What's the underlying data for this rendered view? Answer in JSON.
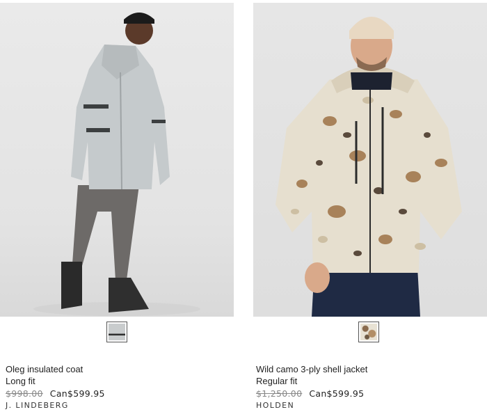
{
  "products": [
    {
      "name": "Oleg insulated coat",
      "fit": "Long fit",
      "old_price": "$998.00",
      "new_price": "Can$599.95",
      "brand": "J. LINDEBERG",
      "swatch_color": "#c9cccd",
      "image_alt": "Oleg insulated coat"
    },
    {
      "name": "Wild camo 3-ply shell jacket",
      "fit": "Regular fit",
      "old_price": "$1,250.00",
      "new_price": "Can$599.95",
      "brand": "HOLDEN",
      "swatch_color": "#b28e66",
      "image_alt": "Wild camo 3-ply shell jacket"
    }
  ]
}
